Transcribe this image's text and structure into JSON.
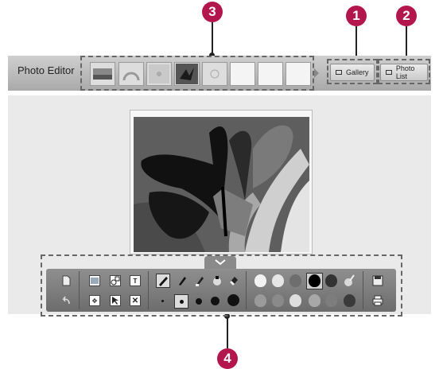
{
  "app": {
    "title": "Photo Editor"
  },
  "nav": {
    "gallery_label": "Gallery",
    "photo_list_label": "Photo List"
  },
  "thumbnails": {
    "count": 8,
    "filled": 5
  },
  "callouts": {
    "c1": "1",
    "c2": "2",
    "c3": "3",
    "c4": "4"
  },
  "toolbar": {
    "new_icon": "new-page-icon",
    "undo_icon": "undo-icon",
    "save_icon": "save-icon",
    "print_icon": "print-icon",
    "text_tool_glyph": "T",
    "delete_glyph": "✕",
    "move_glyph": "✥",
    "collapse_glyph": "⌄"
  },
  "colors": {
    "callout": "#b3164c",
    "bar": "#a9a9a9",
    "toolbar": "#7a7a7a",
    "palette_row1": [
      "#f2f2f2",
      "#e6e6e6",
      "#c8c8c8",
      "#000000",
      "#333333",
      "#d9d9d9"
    ],
    "palette_row2": [
      "#9a9a9a",
      "#b5b5b5",
      "#dedede",
      "#a8a8a8",
      "#7d7d7d",
      "#3a3a3a"
    ]
  }
}
